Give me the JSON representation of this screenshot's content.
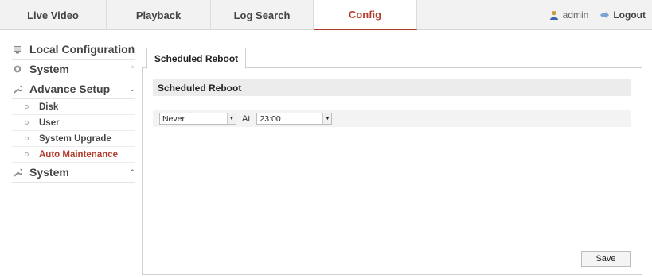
{
  "nav": {
    "tabs": [
      {
        "label": "Live Video"
      },
      {
        "label": "Playback"
      },
      {
        "label": "Log Search"
      },
      {
        "label": "Config"
      }
    ],
    "user": "admin",
    "logout": "Logout"
  },
  "sidebar": {
    "local_config": "Local Configuration",
    "system": "System",
    "advance_setup": "Advance Setup",
    "sub_items": [
      {
        "label": "Disk"
      },
      {
        "label": "User"
      },
      {
        "label": "System Upgrade"
      },
      {
        "label": "Auto Maintenance"
      }
    ],
    "system2": "System"
  },
  "main": {
    "tab_label": "Scheduled Reboot",
    "section_title": "Scheduled Reboot",
    "schedule_value": "Never",
    "at_label": "At",
    "time_value": "23:00",
    "save_label": "Save"
  },
  "colors": {
    "accent": "#b23b2c"
  }
}
